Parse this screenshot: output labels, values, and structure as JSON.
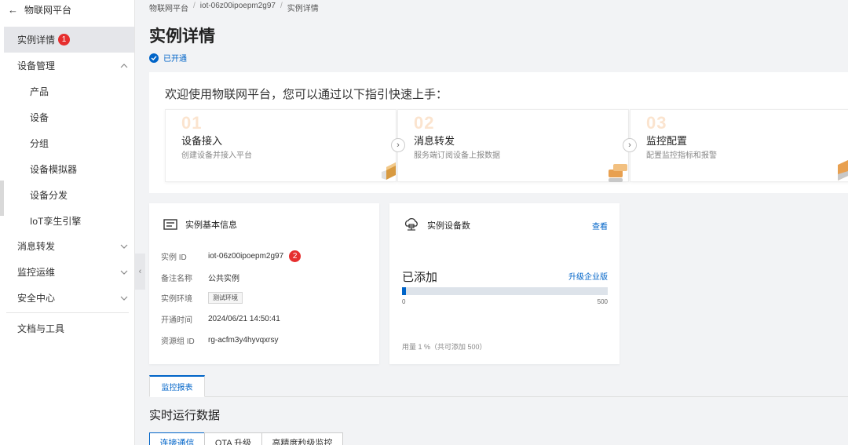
{
  "sidebar": {
    "back_label": "物联网平台",
    "items": [
      {
        "label": "实例详情",
        "badge": "1"
      },
      {
        "label": "设备管理"
      },
      {
        "label": "产品"
      },
      {
        "label": "设备"
      },
      {
        "label": "分组"
      },
      {
        "label": "设备模拟器"
      },
      {
        "label": "设备分发"
      },
      {
        "label": "IoT孪生引擎"
      },
      {
        "label": "消息转发"
      },
      {
        "label": "监控运维"
      },
      {
        "label": "安全中心"
      },
      {
        "label": "文档与工具"
      }
    ]
  },
  "breadcrumb": [
    "物联网平台",
    "iot-06z00ipoepm2g97",
    "实例详情"
  ],
  "page": {
    "title": "实例详情",
    "status": "已开通"
  },
  "guide": {
    "title": "欢迎使用物联网平台，您可以通过以下指引快速上手：",
    "steps": [
      {
        "num": "01",
        "name": "设备接入",
        "desc": "创建设备并接入平台"
      },
      {
        "num": "02",
        "name": "消息转发",
        "desc": "服务端订阅设备上报数据"
      },
      {
        "num": "03",
        "name": "监控配置",
        "desc": "配置监控指标和报警"
      }
    ]
  },
  "instance_info": {
    "title": "实例基本信息",
    "rows": [
      {
        "key": "实例 ID",
        "value": "iot-06z00ipoepm2g97",
        "badge": "2"
      },
      {
        "key": "备注名称",
        "value": "公共实例"
      },
      {
        "key": "实例环境",
        "value": "测试环境"
      },
      {
        "key": "开通时间",
        "value": "2024/06/21 14:50:41"
      },
      {
        "key": "资源组 ID",
        "value": "rg-acfm3y4hyvqxrsy"
      }
    ]
  },
  "device_count": {
    "title": "实例设备数",
    "view_link": "查看",
    "added_label": "已添加",
    "upgrade_link": "升级企业版",
    "bar_min": "0",
    "bar_max": "500",
    "progress_fraction": 0.01,
    "usage_text": "用量 1 %（共可添加 500）"
  },
  "tabs": {
    "monitor": "监控报表"
  },
  "realtime": {
    "title": "实时运行数据",
    "subtabs": [
      "连接通信",
      "OTA 升级",
      "高精度秒级监控"
    ]
  },
  "colors": {
    "accent": "#0064c8",
    "badge": "#e62e2e",
    "step_number": "#fbe4cf"
  }
}
